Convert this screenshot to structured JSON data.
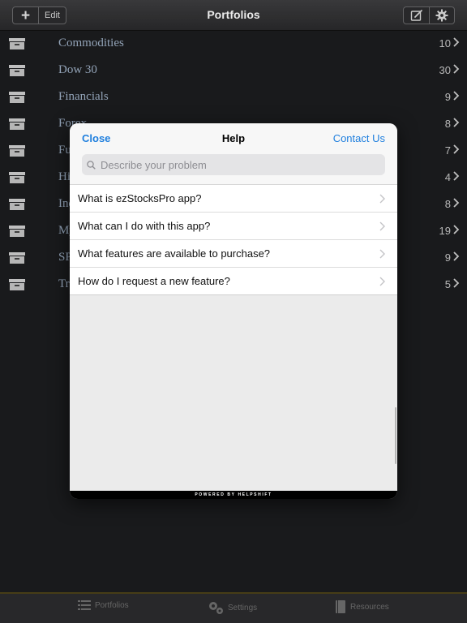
{
  "navbar": {
    "title": "Portfolios",
    "add_label": "+",
    "edit_label": "Edit",
    "compose_icon": "compose-icon",
    "settings_icon": "gear-icon"
  },
  "portfolios": [
    {
      "label": "Commodities",
      "count": "10"
    },
    {
      "label": "Dow 30",
      "count": "30"
    },
    {
      "label": "Financials",
      "count": "9"
    },
    {
      "label": "Forex",
      "count": "8"
    },
    {
      "label": "Futures",
      "count": "7"
    },
    {
      "label": "High",
      "count": "4"
    },
    {
      "label": "Index",
      "count": "8"
    },
    {
      "label": "My",
      "count": "19"
    },
    {
      "label": "SP",
      "count": "9"
    },
    {
      "label": "Tr",
      "count": "5"
    }
  ],
  "help": {
    "close_label": "Close",
    "title": "Help",
    "contact_label": "Contact Us",
    "search_placeholder": "Describe your problem",
    "faqs": [
      {
        "label": "What is ezStocksPro app?"
      },
      {
        "label": "What can I do with this app?"
      },
      {
        "label": "What features are available to purchase?"
      },
      {
        "label": "How do I request a new feature?"
      }
    ],
    "footer": "POWERED BY HELPSHIFT"
  },
  "tabbar": {
    "portfolios_label": "Portfolios",
    "settings_label": "Settings",
    "resources_label": "Resources"
  },
  "colors": {
    "accent": "#1f7fde",
    "row_label": "#9fb1c7",
    "background": "#1c1d1f"
  }
}
